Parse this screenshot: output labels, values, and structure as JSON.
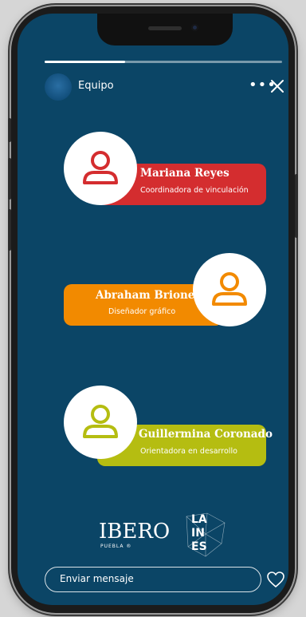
{
  "story": {
    "progress_fraction": 0.34,
    "header": {
      "title": "Equipo",
      "more_icon": "more-horizontal-icon",
      "close_icon": "close-icon"
    }
  },
  "members": [
    {
      "name": "Mariana Reyes",
      "role": "Coordinadora de vinculación",
      "color": "#d42d2f"
    },
    {
      "name": "Abraham Briones",
      "role": "Diseñador gráfico",
      "color": "#f28a00"
    },
    {
      "name": "Guillermina Coronado",
      "role": "Orientadora en desarrollo",
      "color": "#b5bd11"
    }
  ],
  "logos": {
    "ibero": "IBERO",
    "ibero_sub": "PUEBLA ®",
    "laines": [
      "LA",
      "IN",
      "ES"
    ]
  },
  "footer": {
    "message_placeholder": "Enviar mensaje",
    "like_icon": "heart-icon"
  },
  "colors": {
    "screen_bg": "#0b4566"
  }
}
